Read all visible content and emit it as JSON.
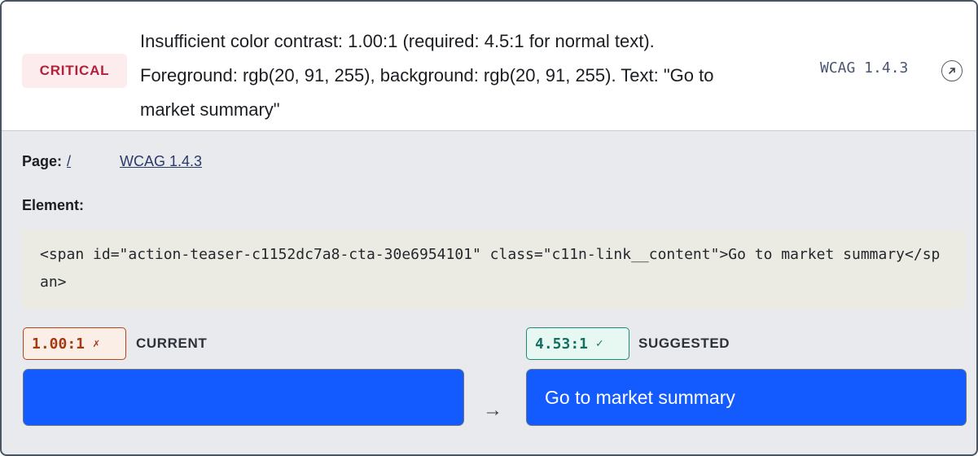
{
  "issue": {
    "severity": "CRITICAL",
    "message_line1": "Insufficient color contrast: 1.00:1 (required: 4.5:1 for normal text).",
    "message_line2": "Foreground: rgb(20, 91, 255), background: rgb(20, 91, 255). Text: \"Go to",
    "message_line3": "market summary\"",
    "wcag_code": "WCAG 1.4.3",
    "link_icon": "external-link-icon"
  },
  "meta": {
    "page_label": "Page:",
    "page_value": "/",
    "wcag_link": "WCAG 1.4.3",
    "element_label": "Element:"
  },
  "element_code": "<span id=\"action-teaser-c1152dc7a8-cta-30e6954101\" class=\"c11n-link__content\">Go to market summary</span>",
  "comparison": {
    "current": {
      "ratio": "1.00:1",
      "mark": "✗",
      "label": "CURRENT",
      "preview_text": ""
    },
    "arrow": "→",
    "suggested": {
      "ratio": "4.53:1",
      "mark": "✓",
      "label": "SUGGESTED",
      "preview_text": "Go to market summary"
    }
  },
  "colors": {
    "preview_bg": "#145bff",
    "critical": "#b3203a",
    "fail": "#a33a12",
    "pass": "#137061"
  }
}
